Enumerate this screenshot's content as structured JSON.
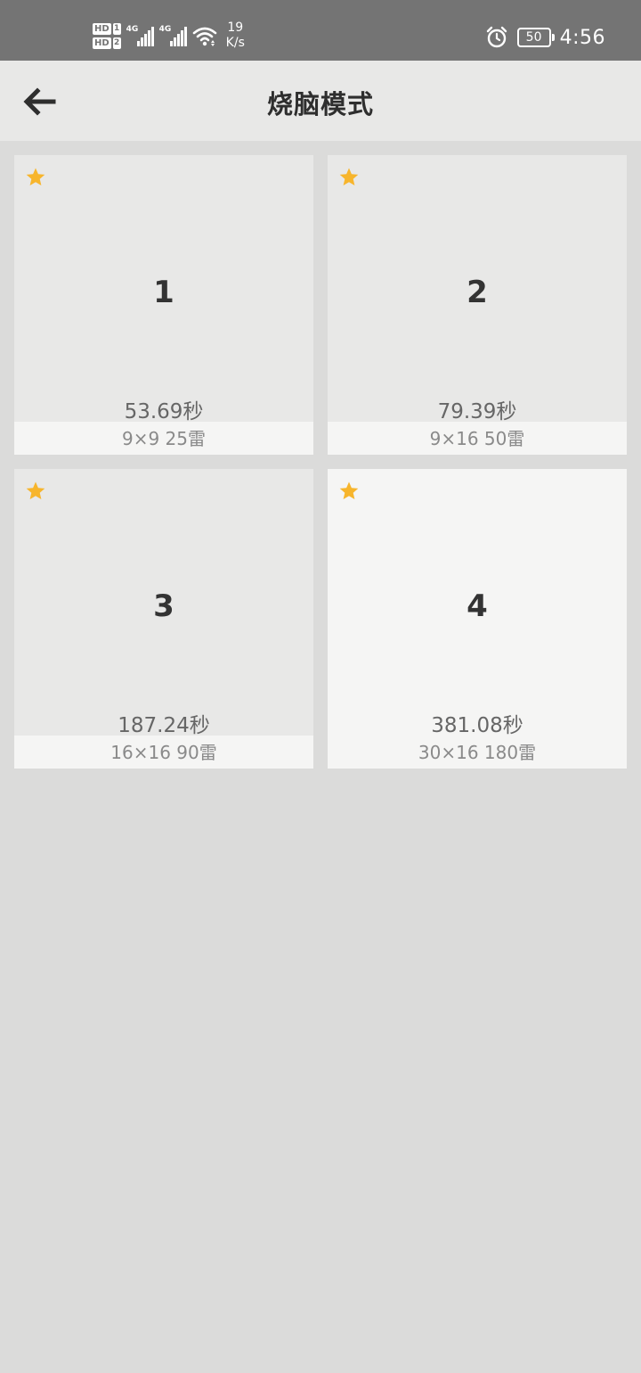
{
  "status_bar": {
    "sim1": {
      "hd": "HD",
      "slot": "1",
      "network": "4G"
    },
    "sim2": {
      "hd": "HD",
      "slot": "2",
      "network": "4G"
    },
    "net_speed_value": "19",
    "net_speed_unit": "K/s",
    "battery": "50",
    "time": "4:56",
    "icons": [
      "signal-icon",
      "wifi-icon",
      "alarm-icon",
      "battery-icon"
    ]
  },
  "header": {
    "title": "烧脑模式",
    "back_icon": "arrow-left-icon"
  },
  "colors": {
    "status_bar_bg": "#747474",
    "app_bar_bg": "#e8e8e7",
    "page_bg": "#dbdbda",
    "star": "#f7b52c"
  },
  "levels": [
    {
      "number": "1",
      "best_time": "53.69秒",
      "size": "9×9",
      "mines": "25雷",
      "info": "9×9  25雷"
    },
    {
      "number": "2",
      "best_time": "79.39秒",
      "size": "9×16",
      "mines": "50雷",
      "info": "9×16  50雷"
    },
    {
      "number": "3",
      "best_time": "187.24秒",
      "size": "16×16",
      "mines": "90雷",
      "info": "16×16  90雷"
    },
    {
      "number": "4",
      "best_time": "381.08秒",
      "size": "30×16",
      "mines": "180雷",
      "info": "30×16  180雷"
    }
  ]
}
